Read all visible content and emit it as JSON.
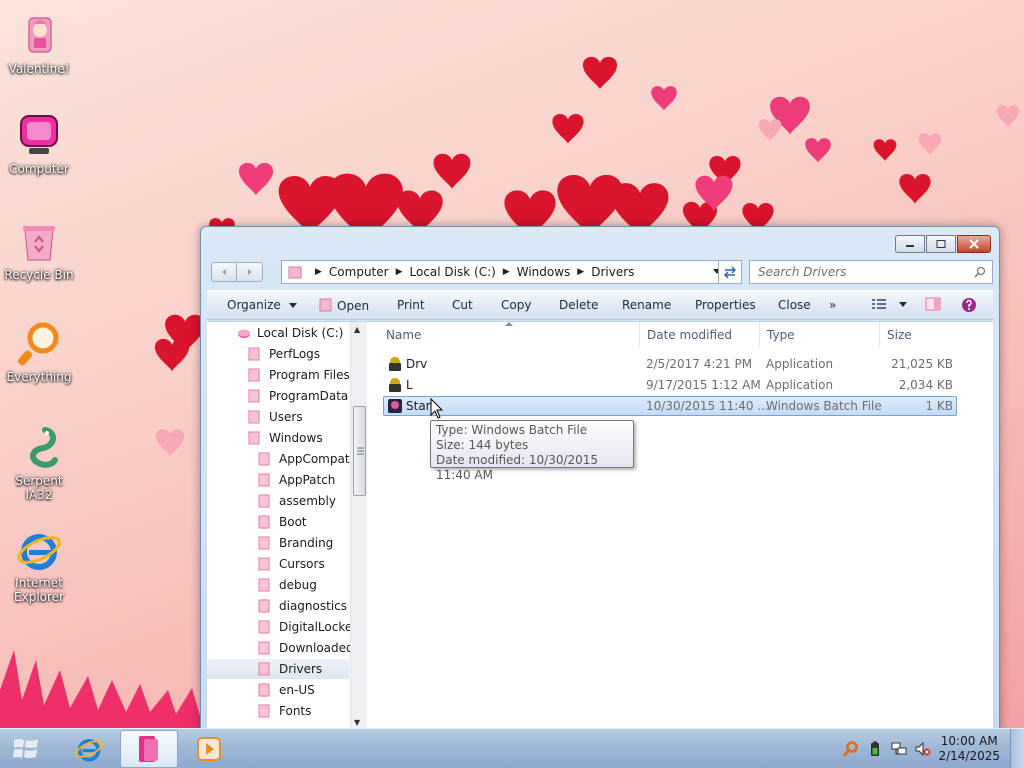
{
  "desktop": {
    "icons": [
      {
        "label": "Valentine!"
      },
      {
        "label": "Computer"
      },
      {
        "label": "Recycle Bin"
      },
      {
        "label": "Everything"
      },
      {
        "label": "Serpent IA32"
      },
      {
        "label": "Internet\nExplorer"
      }
    ]
  },
  "explorer": {
    "address": {
      "crumbs": [
        "Computer",
        "Local Disk (C:)",
        "Windows",
        "Drivers"
      ]
    },
    "search_placeholder": "Search Drivers",
    "toolbar": {
      "organize": "Organize",
      "open": "Open",
      "print": "Print",
      "cut": "Cut",
      "copy": "Copy",
      "delete": "Delete",
      "rename": "Rename",
      "properties": "Properties",
      "close": "Close",
      "more": "»"
    },
    "tree": {
      "root": "Local Disk (C:)",
      "items": [
        "PerfLogs",
        "Program Files",
        "ProgramData",
        "Users",
        "Windows"
      ],
      "windows_children": [
        "AppCompat",
        "AppPatch",
        "assembly",
        "Boot",
        "Branding",
        "Cursors",
        "debug",
        "diagnostics",
        "DigitalLocker",
        "Downloaded",
        "Drivers",
        "en-US",
        "Fonts"
      ],
      "selected": "Drivers"
    },
    "columns": {
      "name": "Name",
      "date": "Date modified",
      "type": "Type",
      "size": "Size"
    },
    "files": [
      {
        "name": "Drv",
        "date": "2/5/2017 4:21 PM",
        "type": "Application",
        "size": "21,025 KB"
      },
      {
        "name": "L",
        "date": "9/17/2015 1:12 AM",
        "type": "Application",
        "size": "2,034 KB"
      },
      {
        "name": "Start",
        "date": "10/30/2015 11:40 ...",
        "type": "Windows Batch File",
        "size": "1 KB"
      }
    ],
    "tooltip": {
      "line1": "Type: Windows Batch File",
      "line2": "Size: 144 bytes",
      "line3": "Date modified: 10/30/2015 11:40 AM"
    }
  },
  "taskbar": {
    "clock_time": "10:00 AM",
    "clock_date": "2/14/2025"
  },
  "colors": {
    "heart": "#d9142c",
    "heart_light": "#f06a8a",
    "accent": "#e8308a",
    "selection": "#c4dcf8"
  },
  "icons": {
    "start": "windows-logo-icon",
    "ie": "internet-explorer-icon",
    "explorer": "pink-folder-icon",
    "media": "media-player-icon"
  }
}
